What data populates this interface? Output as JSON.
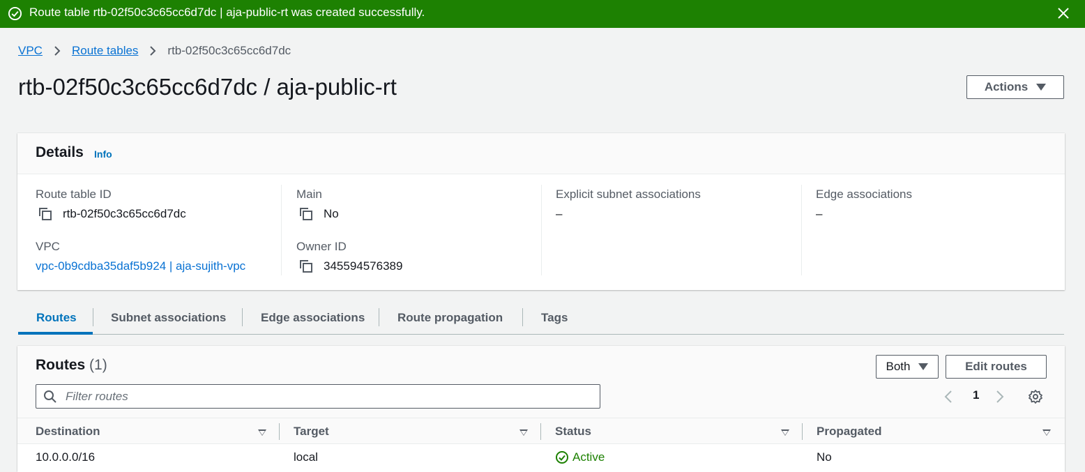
{
  "flash": {
    "message": "Route table rtb-02f50c3c65cc6d7dc | aja-public-rt was created successfully."
  },
  "breadcrumb": {
    "items": [
      "VPC",
      "Route tables",
      "rtb-02f50c3c65cc6d7dc"
    ]
  },
  "page": {
    "title": "rtb-02f50c3c65cc6d7dc / aja-public-rt",
    "actions_label": "Actions"
  },
  "details": {
    "title": "Details",
    "info_label": "Info",
    "route_table_id": {
      "label": "Route table ID",
      "value": "rtb-02f50c3c65cc6d7dc"
    },
    "main": {
      "label": "Main",
      "value": "No"
    },
    "explicit_subnet": {
      "label": "Explicit subnet associations",
      "value": "–"
    },
    "edge": {
      "label": "Edge associations",
      "value": "–"
    },
    "vpc": {
      "label": "VPC",
      "value": "vpc-0b9cdba35daf5b924 | aja-sujith-vpc"
    },
    "owner": {
      "label": "Owner ID",
      "value": "345594576389"
    }
  },
  "tabs": [
    "Routes",
    "Subnet associations",
    "Edge associations",
    "Route propagation",
    "Tags"
  ],
  "routes": {
    "title": "Routes",
    "count": "(1)",
    "filter_select": "Both",
    "edit_label": "Edit routes",
    "search_placeholder": "Filter routes",
    "page_number": "1",
    "columns": [
      "Destination",
      "Target",
      "Status",
      "Propagated"
    ],
    "rows": [
      {
        "destination": "10.0.0.0/16",
        "target": "local",
        "status": "Active",
        "propagated": "No"
      }
    ]
  },
  "colors": {
    "success": "#1d8102",
    "link": "#0972d3",
    "accent": "#0073bb"
  }
}
